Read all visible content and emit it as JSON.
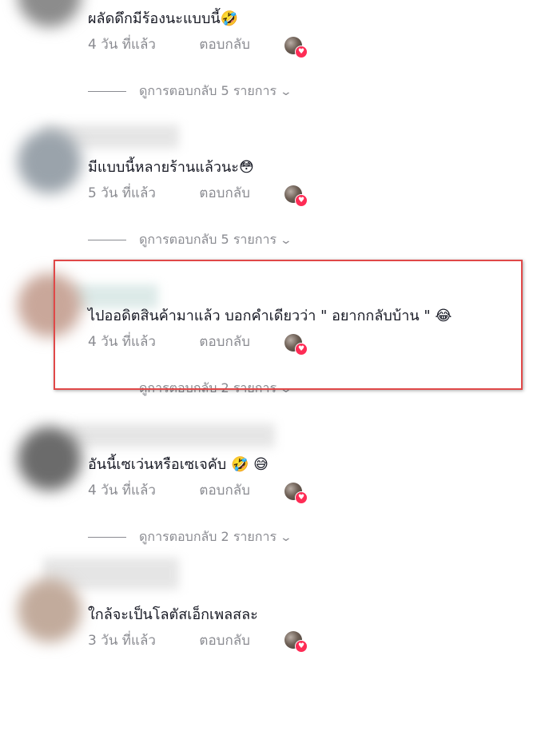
{
  "comments": [
    {
      "text": "ผลัดดึกมีร้องนะแบบนี้🤣",
      "time": "4 วัน ที่แล้ว",
      "reply_label": "ตอบกลับ",
      "view_replies": "ดูการตอบกลับ 5 รายการ"
    },
    {
      "text": "มีแบบนี้หลายร้านแล้วนะ😳",
      "time": "5 วัน ที่แล้ว",
      "reply_label": "ตอบกลับ",
      "view_replies": "ดูการตอบกลับ 5 รายการ"
    },
    {
      "text": "ไปออดิตสินค้ามาแล้ว บอกคำเดียวว่า \" อยากกลับบ้าน \" 😂",
      "time": "4 วัน ที่แล้ว",
      "reply_label": "ตอบกลับ",
      "view_replies": "ดูการตอบกลับ 2 รายการ"
    },
    {
      "text": "อันนี้เซเว่นหรือเซเจคับ 🤣 😅",
      "time": "4 วัน ที่แล้ว",
      "reply_label": "ตอบกลับ",
      "view_replies": "ดูการตอบกลับ 2 รายการ"
    },
    {
      "text": "ใกล้จะเป็นโลตัสเอ็กเพลสละ",
      "time": "3 วัน ที่แล้ว",
      "reply_label": "ตอบกลับ"
    }
  ],
  "chevron_icon": "chevron-down-icon",
  "liked_by_creator_icon": "heart-icon",
  "colors": {
    "text": "#161823",
    "secondary": "#8a8b91",
    "heart": "#fe2c55",
    "highlight_border": "#e04848"
  }
}
